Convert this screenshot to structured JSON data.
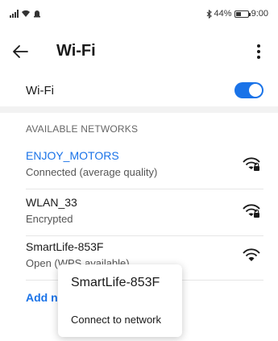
{
  "status_bar": {
    "battery_text": "44%",
    "time": "9:00",
    "battery_level": 0.44
  },
  "app_bar": {
    "title": "Wi-Fi",
    "back_icon": "arrow-left-icon",
    "more_icon": "more-vertical-icon"
  },
  "wifi_toggle": {
    "label": "Wi-Fi",
    "enabled": true
  },
  "section_header": "AVAILABLE NETWORKS",
  "networks": [
    {
      "name": "ENJOY_MOTORS",
      "status": "Connected (average quality)",
      "connected": true,
      "secured": true
    },
    {
      "name": "WLAN_33",
      "status": "Encrypted",
      "connected": false,
      "secured": true
    },
    {
      "name": "SmartLife-853F",
      "status": "Open (WPS available)",
      "connected": false,
      "secured": false
    }
  ],
  "add_network": "Add n",
  "popup": {
    "title": "SmartLife-853F",
    "action": "Connect to network"
  },
  "colors": {
    "accent": "#1a73e8",
    "text": "#1a1a1a",
    "muted": "#666666"
  }
}
